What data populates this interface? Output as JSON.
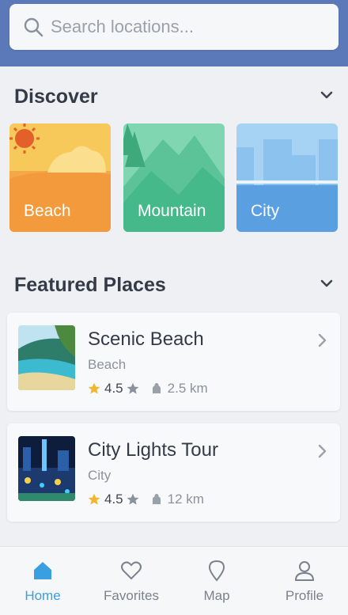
{
  "search": {
    "placeholder": "Search locations..."
  },
  "discover": {
    "title": "Discover",
    "categories": [
      {
        "label": "Beach"
      },
      {
        "label": "Mountain"
      },
      {
        "label": "City"
      }
    ]
  },
  "featured": {
    "title": "Featured Places",
    "places": [
      {
        "title": "Scenic Beach",
        "category": "Beach",
        "rating": "4.5",
        "distance": "2.5 km"
      },
      {
        "title": "City Lights Tour",
        "category": "City",
        "rating": "4.5",
        "distance": "12 km"
      }
    ]
  },
  "tabs": [
    {
      "label": "Home",
      "icon": "home-icon",
      "active": true
    },
    {
      "label": "Favorites",
      "icon": "heart-icon"
    },
    {
      "label": "Map",
      "icon": "map-pin-icon"
    },
    {
      "label": "Profile",
      "icon": "user-icon"
    }
  ],
  "colors": {
    "header": "#5b78b8",
    "beach": "#f0963e",
    "mountain": "#46b98a",
    "city": "#5a9fe0",
    "active_tab": "#3a9fe0",
    "star": "#f2b632"
  }
}
